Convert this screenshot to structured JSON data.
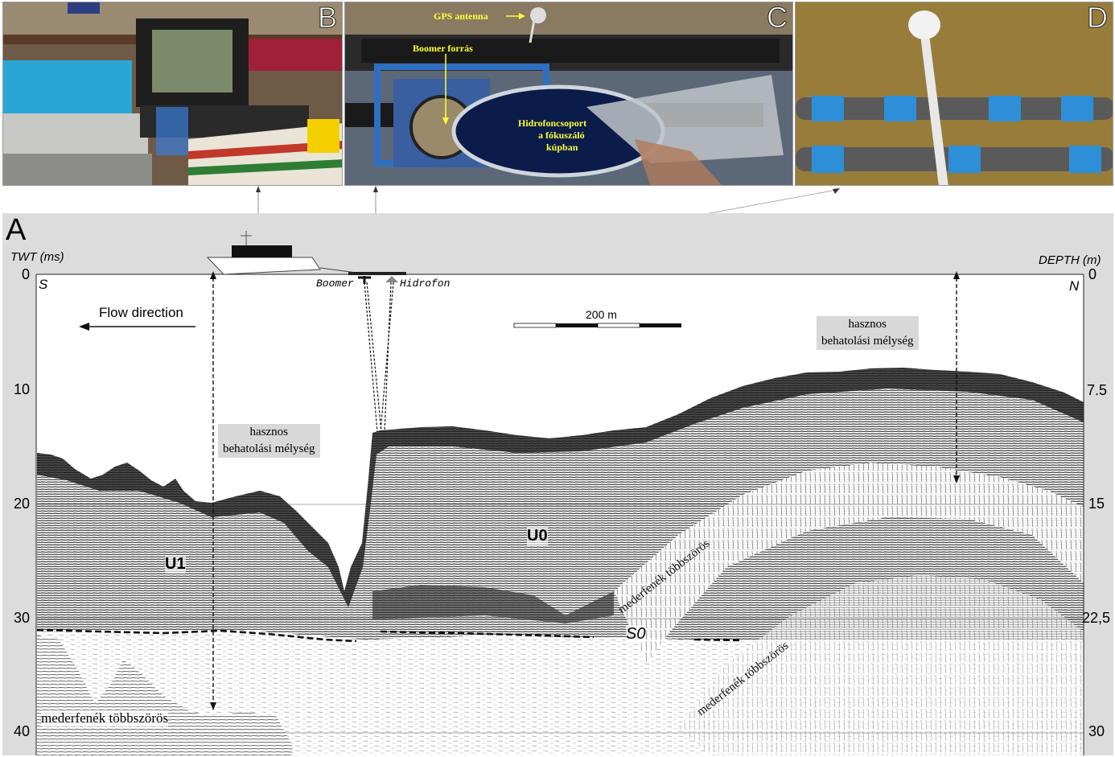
{
  "panels": {
    "b": {
      "letter": "B"
    },
    "c": {
      "letter": "C",
      "gps_antenna": "GPS antenna",
      "boomer_source": "Boomer forrás",
      "hydrophone_line1": "Hidrofoncsoport",
      "hydrophone_line2": "a fókuszáló",
      "hydrophone_line3": "kúpban"
    },
    "d": {
      "letter": "D"
    }
  },
  "profile": {
    "letter": "A",
    "left_axis_title": "TWT (ms)",
    "right_axis_title": "DEPTH (m)",
    "left_ticks": [
      "0",
      "10",
      "20",
      "30",
      "40"
    ],
    "right_ticks": [
      "0",
      "7.5",
      "15",
      "22,5",
      "30"
    ],
    "south": "S",
    "north": "N",
    "flow_direction": "Flow direction",
    "scale_label": "200 m",
    "boomer": "Boomer",
    "hydrophone": "Hidrofon",
    "penetration_line1": "hasznos",
    "penetration_line2": "behatolási mélység",
    "unit_u0": "U0",
    "unit_u1": "U1",
    "reflector_s0": "S0",
    "multiple": "mederfenék többszörös"
  },
  "colors": {
    "panel_bg": "#dcdcdc",
    "annotation_yellow": "#ffff33",
    "label_box": "#d8d8d8"
  }
}
